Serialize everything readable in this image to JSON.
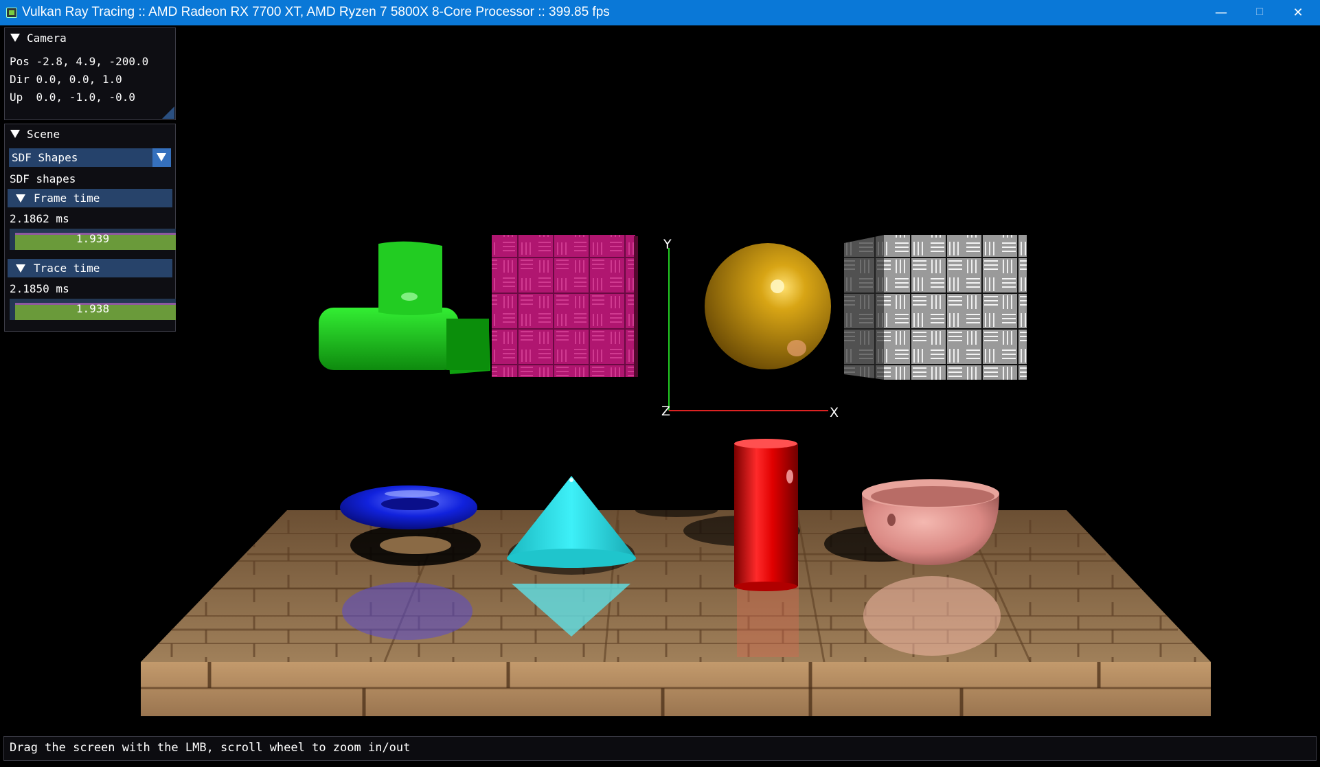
{
  "window": {
    "title": "Vulkan Ray Tracing :: AMD Radeon RX 7700 XT, AMD Ryzen 7 5800X 8-Core Processor :: 399.85 fps",
    "controls": {
      "minimize": "—",
      "maximize": "☐",
      "close": "✕"
    }
  },
  "camera_panel": {
    "title": "Camera",
    "pos": "Pos -2.8, 4.9, -200.0",
    "dir": "Dir 0.0, 0.0, 1.0",
    "up": "Up  0.0, -1.0, -0.0"
  },
  "scene_panel": {
    "title": "Scene",
    "scene_select": {
      "selected": "SDF Shapes"
    },
    "description": "SDF shapes",
    "frame_time": {
      "header": "Frame time",
      "value": "2.1862 ms",
      "histogram_label": "1.939"
    },
    "trace_time": {
      "header": "Trace time",
      "value": "2.1850 ms",
      "histogram_label": "1.938"
    }
  },
  "axes": {
    "x": "X",
    "y": "Y",
    "z": "Z"
  },
  "status": {
    "text": "Drag the screen with the LMB, scroll wheel to zoom in/out"
  },
  "colors": {
    "titlebar": "#0a78d7",
    "green_shape": "#22cc22",
    "magenta_box": "#b01670",
    "gold_sphere": "#c99a10",
    "blue_torus": "#1122dd",
    "cyan_cone": "#22d8e0",
    "red_cylinder": "#e01010",
    "pink_bowl": "#d98883",
    "wood_floor": "#8a6a45"
  }
}
